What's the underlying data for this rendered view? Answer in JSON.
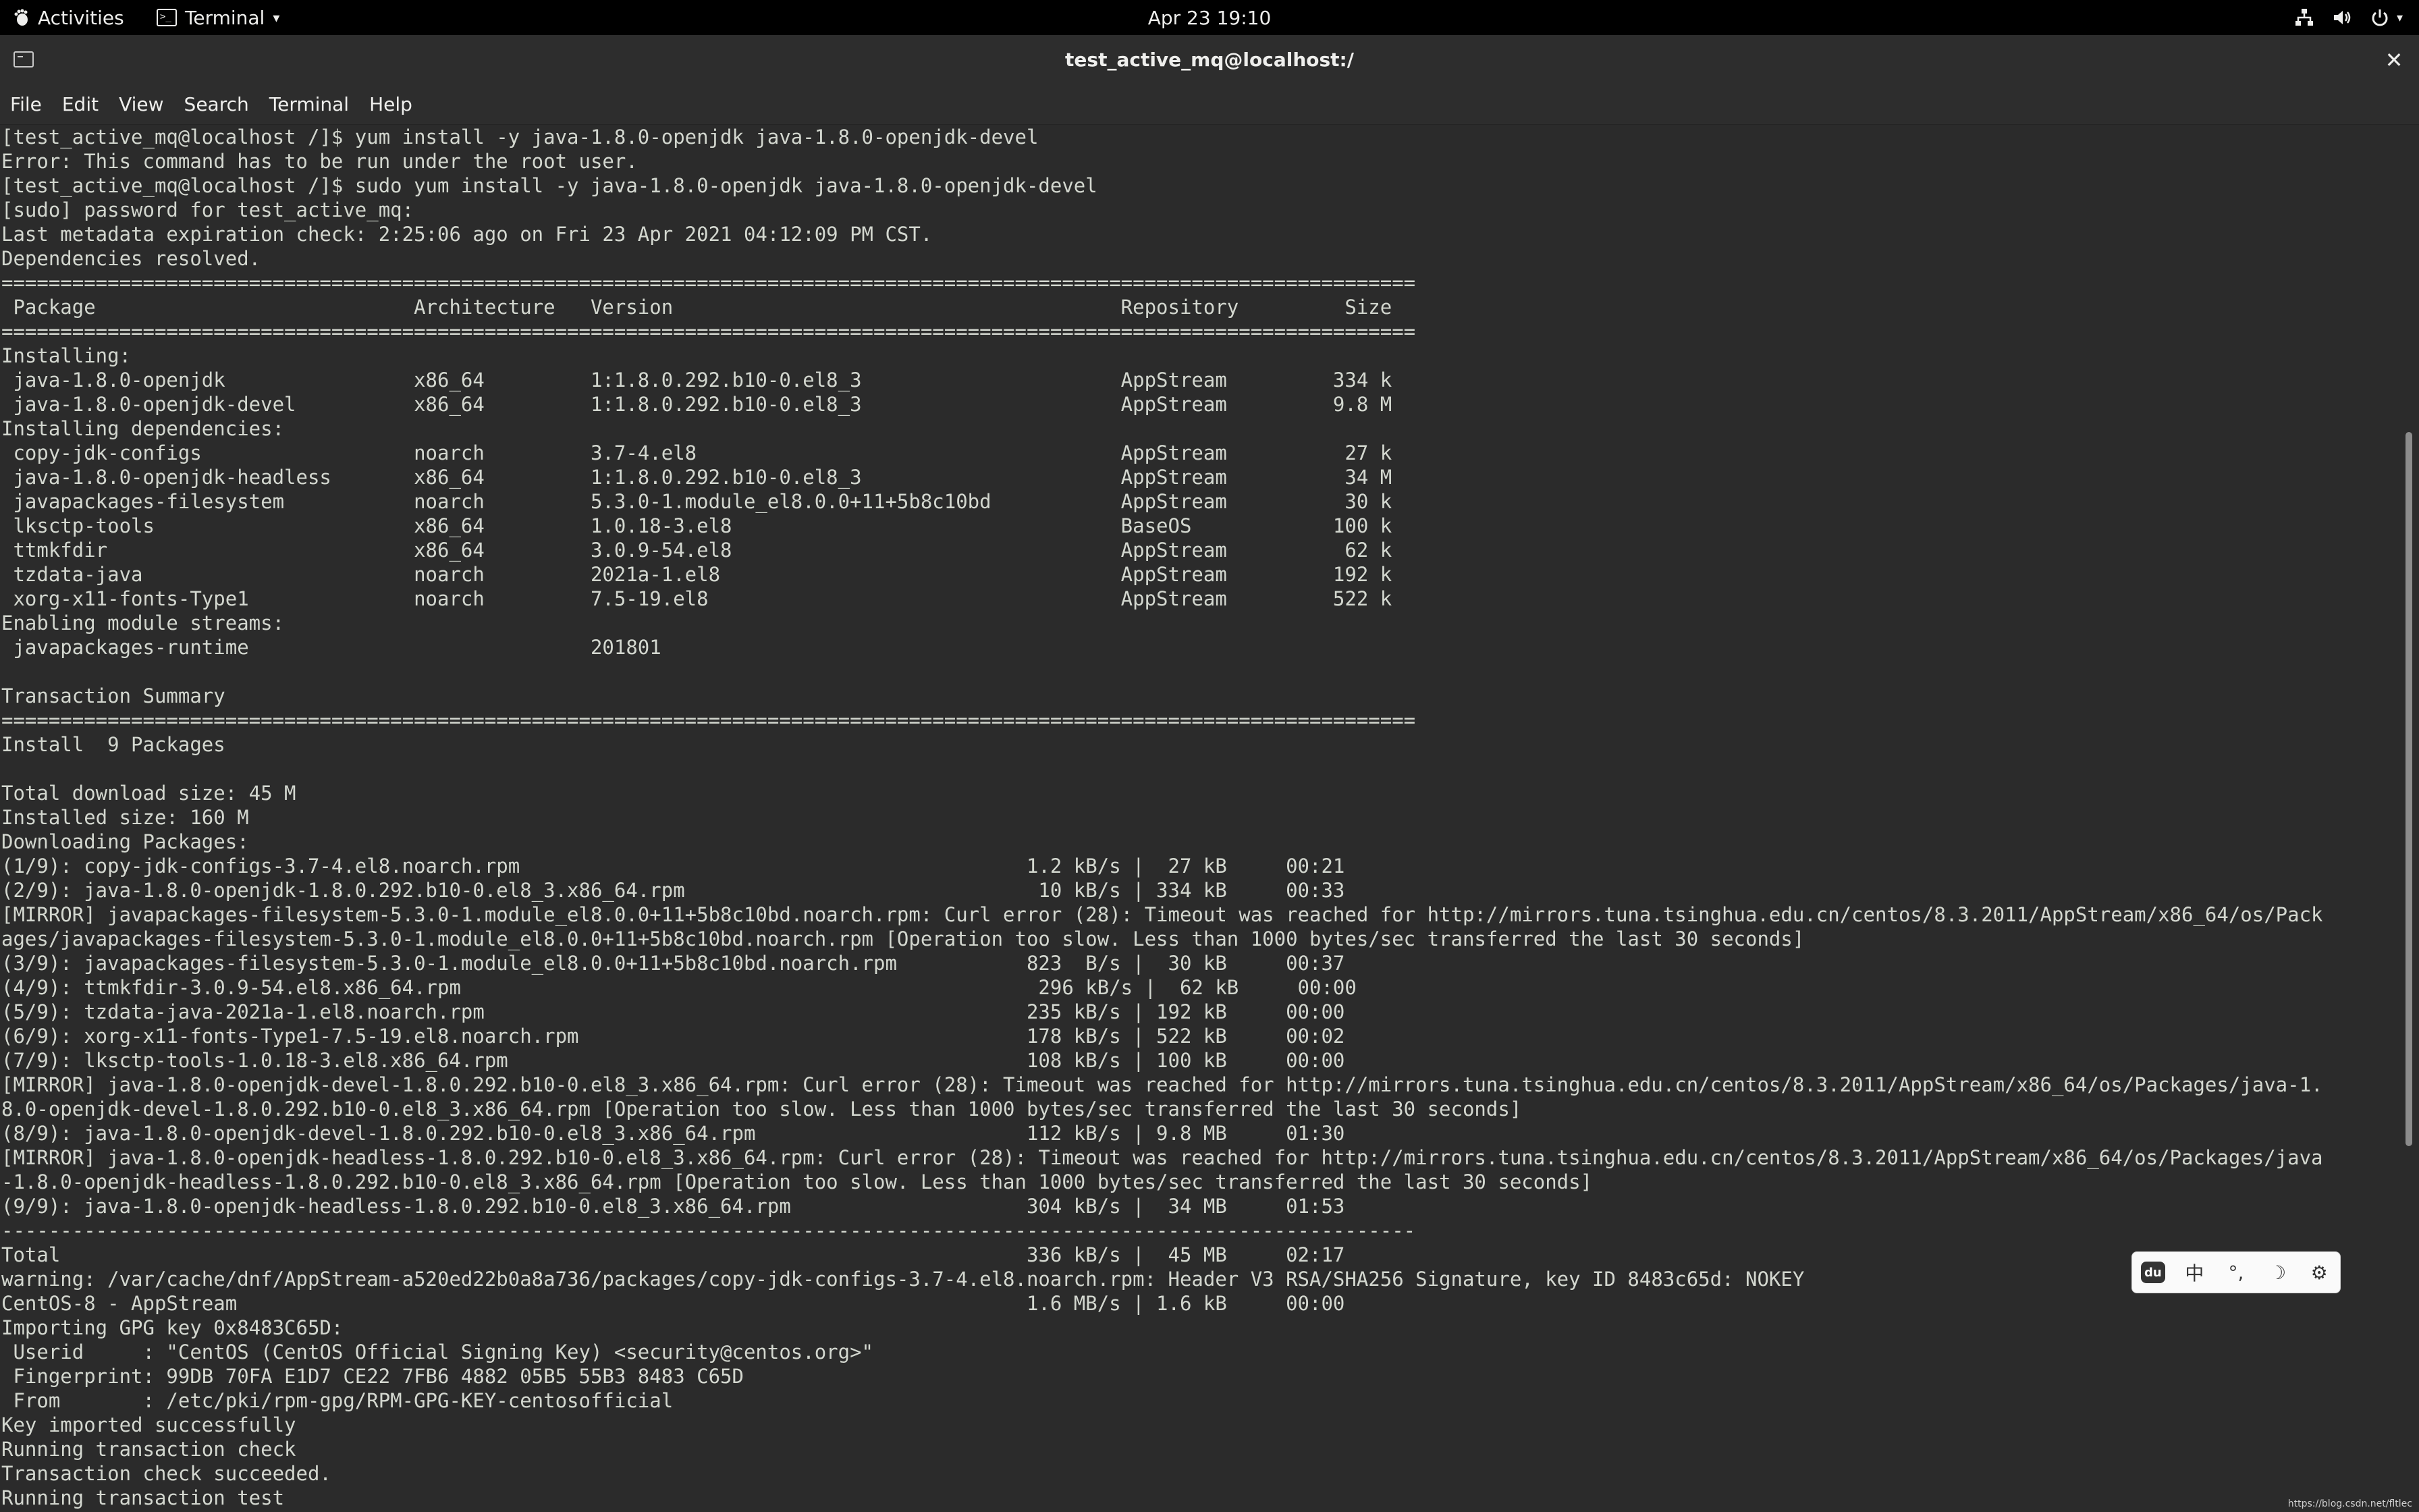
{
  "topbar": {
    "activities": "Activities",
    "app_menu": "Terminal",
    "clock": "Apr 23  19:10",
    "icons": [
      "network-icon",
      "volume-icon",
      "power-icon"
    ]
  },
  "window": {
    "title": "test_active_mq@localhost:/",
    "close_glyph": "✕"
  },
  "menubar": {
    "items": [
      "File",
      "Edit",
      "View",
      "Search",
      "Terminal",
      "Help"
    ]
  },
  "terminal": {
    "lines": [
      "[test_active_mq@localhost /]$ yum install -y java-1.8.0-openjdk java-1.8.0-openjdk-devel",
      "Error: This command has to be run under the root user.",
      "[test_active_mq@localhost /]$ sudo yum install -y java-1.8.0-openjdk java-1.8.0-openjdk-devel",
      "[sudo] password for test_active_mq:",
      "Last metadata expiration check: 2:25:06 ago on Fri 23 Apr 2021 04:12:09 PM CST.",
      "Dependencies resolved.",
      "========================================================================================================================",
      " Package                           Architecture   Version                                      Repository         Size",
      "========================================================================================================================",
      "Installing:",
      " java-1.8.0-openjdk                x86_64         1:1.8.0.292.b10-0.el8_3                      AppStream         334 k",
      " java-1.8.0-openjdk-devel          x86_64         1:1.8.0.292.b10-0.el8_3                      AppStream         9.8 M",
      "Installing dependencies:",
      " copy-jdk-configs                  noarch         3.7-4.el8                                    AppStream          27 k",
      " java-1.8.0-openjdk-headless       x86_64         1:1.8.0.292.b10-0.el8_3                      AppStream          34 M",
      " javapackages-filesystem           noarch         5.3.0-1.module_el8.0.0+11+5b8c10bd           AppStream          30 k",
      " lksctp-tools                      x86_64         1.0.18-3.el8                                 BaseOS            100 k",
      " ttmkfdir                          x86_64         3.0.9-54.el8                                 AppStream          62 k",
      " tzdata-java                       noarch         2021a-1.el8                                  AppStream         192 k",
      " xorg-x11-fonts-Type1              noarch         7.5-19.el8                                   AppStream         522 k",
      "Enabling module streams:",
      " javapackages-runtime                             201801",
      "",
      "Transaction Summary",
      "========================================================================================================================",
      "Install  9 Packages",
      "",
      "Total download size: 45 M",
      "Installed size: 160 M",
      "Downloading Packages:",
      "(1/9): copy-jdk-configs-3.7-4.el8.noarch.rpm                                           1.2 kB/s |  27 kB     00:21",
      "(2/9): java-1.8.0-openjdk-1.8.0.292.b10-0.el8_3.x86_64.rpm                              10 kB/s | 334 kB     00:33",
      "[MIRROR] javapackages-filesystem-5.3.0-1.module_el8.0.0+11+5b8c10bd.noarch.rpm: Curl error (28): Timeout was reached for http://mirrors.tuna.tsinghua.edu.cn/centos/8.3.2011/AppStream/x86_64/os/Pack",
      "ages/javapackages-filesystem-5.3.0-1.module_el8.0.0+11+5b8c10bd.noarch.rpm [Operation too slow. Less than 1000 bytes/sec transferred the last 30 seconds]",
      "(3/9): javapackages-filesystem-5.3.0-1.module_el8.0.0+11+5b8c10bd.noarch.rpm           823  B/s |  30 kB     00:37",
      "(4/9): ttmkfdir-3.0.9-54.el8.x86_64.rpm                                                 296 kB/s |  62 kB     00:00",
      "(5/9): tzdata-java-2021a-1.el8.noarch.rpm                                              235 kB/s | 192 kB     00:00",
      "(6/9): xorg-x11-fonts-Type1-7.5-19.el8.noarch.rpm                                      178 kB/s | 522 kB     00:02",
      "(7/9): lksctp-tools-1.0.18-3.el8.x86_64.rpm                                            108 kB/s | 100 kB     00:00",
      "[MIRROR] java-1.8.0-openjdk-devel-1.8.0.292.b10-0.el8_3.x86_64.rpm: Curl error (28): Timeout was reached for http://mirrors.tuna.tsinghua.edu.cn/centos/8.3.2011/AppStream/x86_64/os/Packages/java-1.",
      "8.0-openjdk-devel-1.8.0.292.b10-0.el8_3.x86_64.rpm [Operation too slow. Less than 1000 bytes/sec transferred the last 30 seconds]",
      "(8/9): java-1.8.0-openjdk-devel-1.8.0.292.b10-0.el8_3.x86_64.rpm                       112 kB/s | 9.8 MB     01:30",
      "[MIRROR] java-1.8.0-openjdk-headless-1.8.0.292.b10-0.el8_3.x86_64.rpm: Curl error (28): Timeout was reached for http://mirrors.tuna.tsinghua.edu.cn/centos/8.3.2011/AppStream/x86_64/os/Packages/java",
      "-1.8.0-openjdk-headless-1.8.0.292.b10-0.el8_3.x86_64.rpm [Operation too slow. Less than 1000 bytes/sec transferred the last 30 seconds]",
      "(9/9): java-1.8.0-openjdk-headless-1.8.0.292.b10-0.el8_3.x86_64.rpm                    304 kB/s |  34 MB     01:53",
      "------------------------------------------------------------------------------------------------------------------------",
      "Total                                                                                  336 kB/s |  45 MB     02:17",
      "warning: /var/cache/dnf/AppStream-a520ed22b0a8a736/packages/copy-jdk-configs-3.7-4.el8.noarch.rpm: Header V3 RSA/SHA256 Signature, key ID 8483c65d: NOKEY",
      "CentOS-8 - AppStream                                                                   1.6 MB/s | 1.6 kB     00:00",
      "Importing GPG key 0x8483C65D:",
      " Userid     : \"CentOS (CentOS Official Signing Key) <security@centos.org>\"",
      " Fingerprint: 99DB 70FA E1D7 CE22 7FB6 4882 05B5 55B3 8483 C65D",
      " From       : /etc/pki/rpm-gpg/RPM-GPG-KEY-centosofficial",
      "Key imported successfully",
      "Running transaction check",
      "Transaction check succeeded.",
      "Running transaction test"
    ]
  },
  "ime": {
    "logo": "du",
    "buttons": [
      "中",
      "°,",
      "☽",
      "⚙"
    ]
  },
  "watermark": "https://blog.csdn.net/fltlec"
}
